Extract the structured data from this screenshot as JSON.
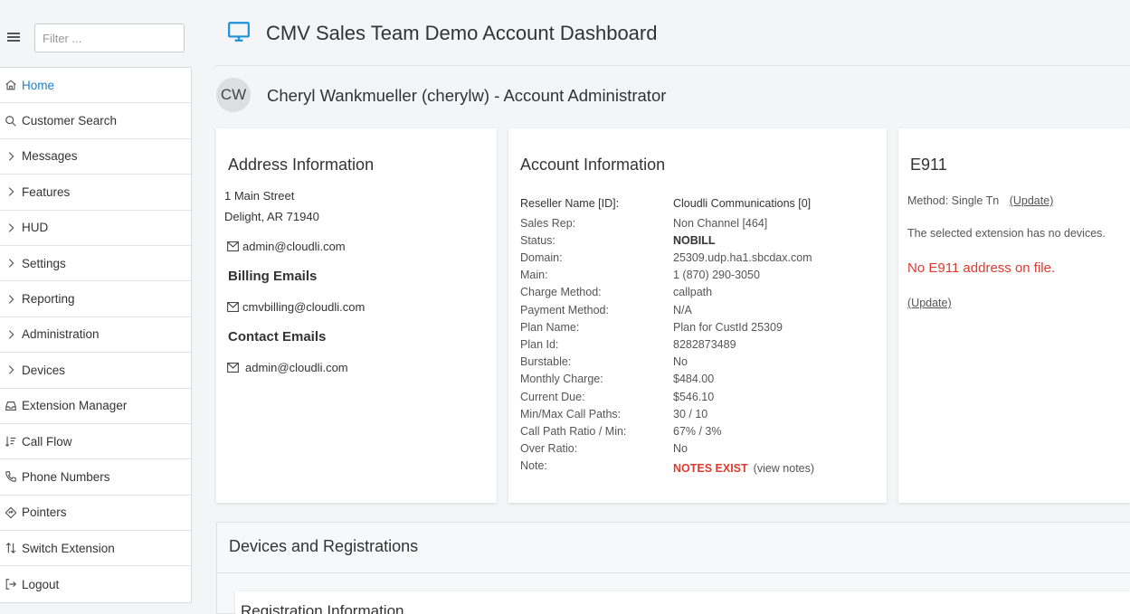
{
  "sidebar": {
    "filter_placeholder": "Filter ...",
    "items": [
      {
        "label": "Home",
        "icon": "home-icon"
      },
      {
        "label": "Customer Search",
        "icon": "search-icon"
      },
      {
        "label": "Messages",
        "icon": "chevron-right-icon"
      },
      {
        "label": "Features",
        "icon": "chevron-right-icon"
      },
      {
        "label": "HUD",
        "icon": "chevron-right-icon"
      },
      {
        "label": "Settings",
        "icon": "chevron-right-icon"
      },
      {
        "label": "Reporting",
        "icon": "chevron-right-icon"
      },
      {
        "label": "Administration",
        "icon": "chevron-right-icon"
      },
      {
        "label": "Devices",
        "icon": "chevron-right-icon"
      },
      {
        "label": "Extension Manager",
        "icon": "inbox-icon"
      },
      {
        "label": "Call Flow",
        "icon": "sort-icon"
      },
      {
        "label": "Phone Numbers",
        "icon": "phone-icon"
      },
      {
        "label": "Pointers",
        "icon": "diamond-icon"
      },
      {
        "label": "Switch Extension",
        "icon": "swap-icon"
      },
      {
        "label": "Logout",
        "icon": "logout-icon"
      }
    ]
  },
  "header": {
    "title": "CMV Sales Team Demo Account Dashboard",
    "icon": "monitor-icon"
  },
  "user": {
    "initials": "CW",
    "line": "Cheryl Wankmueller (cherylw) - Account Administrator"
  },
  "address": {
    "title": "Address Information",
    "street": "1 Main Street",
    "city": "Delight, AR 71940",
    "email": "admin@cloudli.com",
    "billing_title": "Billing Emails",
    "billing_email": "cmvbilling@cloudli.com",
    "contact_title": "Contact Emails",
    "contact_email": "admin@cloudli.com"
  },
  "account": {
    "title": "Account Information",
    "rows": [
      {
        "k": "Reseller Name [ID]:",
        "v": "Cloudli Communications [0]"
      },
      {
        "k": "Sales Rep:",
        "v": "Non Channel [464]"
      },
      {
        "k": "Status:",
        "v": "NOBILL"
      },
      {
        "k": "Domain:",
        "v": "25309.udp.ha1.sbcdax.com"
      },
      {
        "k": "Main:",
        "v": "1 (870) 290-3050"
      },
      {
        "k": "Charge Method:",
        "v": "callpath"
      },
      {
        "k": "Payment Method:",
        "v": "N/A"
      },
      {
        "k": "Plan Name:",
        "v": "Plan for CustId 25309"
      },
      {
        "k": "Plan Id:",
        "v": "8282873489"
      },
      {
        "k": "Burstable:",
        "v": "No"
      },
      {
        "k": "Monthly Charge:",
        "v": "$484.00"
      },
      {
        "k": "Current Due:",
        "v": "$546.10"
      },
      {
        "k": "Min/Max Call Paths:",
        "v": "30 / 10"
      },
      {
        "k": "Call Path Ratio / Min:",
        "v": "67% / 3%"
      },
      {
        "k": "Over Ratio:",
        "v": "No"
      },
      {
        "k": "Note:",
        "v": "NOTES EXIST"
      }
    ],
    "view_notes": "(view notes)"
  },
  "e911": {
    "title": "E911",
    "method": "Method: Single Tn",
    "update_label": "(Update)",
    "no_devices": "The selected extension has no devices.",
    "alert": "No E911 address on file.",
    "update_label2": "(Update)",
    "alert_color": "#e03a2f"
  },
  "devices": {
    "title": "Devices and Registrations",
    "registration_title": "Registration Information"
  },
  "colors": {
    "accent": "#1d8fd8",
    "active_link": "#1d7fc4",
    "danger": "#e03a2f"
  }
}
